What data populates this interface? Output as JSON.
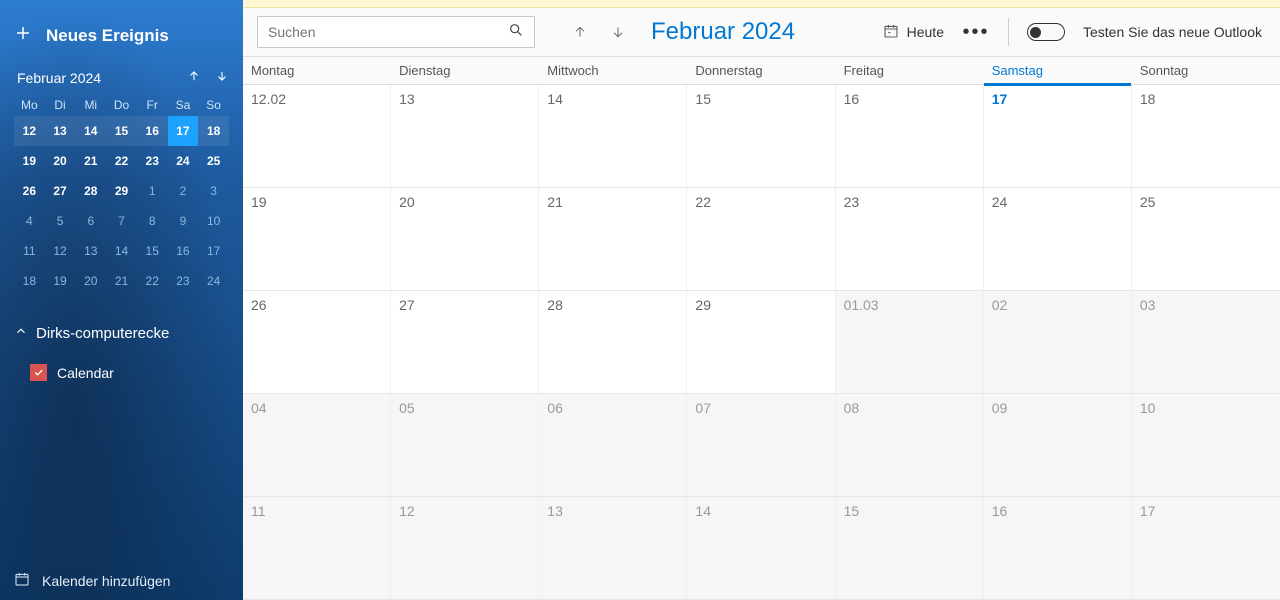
{
  "sidebar": {
    "new_event": "Neues Ereignis",
    "mini": {
      "title": "Februar 2024",
      "dow": [
        "Mo",
        "Di",
        "Mi",
        "Do",
        "Fr",
        "Sa",
        "So"
      ],
      "cells": [
        {
          "n": "12",
          "cls": "in-month week-hl"
        },
        {
          "n": "13",
          "cls": "in-month week-hl"
        },
        {
          "n": "14",
          "cls": "in-month week-hl"
        },
        {
          "n": "15",
          "cls": "in-month week-hl"
        },
        {
          "n": "16",
          "cls": "in-month week-hl"
        },
        {
          "n": "17",
          "cls": "in-month today"
        },
        {
          "n": "18",
          "cls": "in-month week-hl"
        },
        {
          "n": "19",
          "cls": "in-month"
        },
        {
          "n": "20",
          "cls": "in-month"
        },
        {
          "n": "21",
          "cls": "in-month"
        },
        {
          "n": "22",
          "cls": "in-month"
        },
        {
          "n": "23",
          "cls": "in-month"
        },
        {
          "n": "24",
          "cls": "in-month"
        },
        {
          "n": "25",
          "cls": "in-month"
        },
        {
          "n": "26",
          "cls": "in-month"
        },
        {
          "n": "27",
          "cls": "in-month"
        },
        {
          "n": "28",
          "cls": "in-month"
        },
        {
          "n": "29",
          "cls": "in-month"
        },
        {
          "n": "1",
          "cls": "other"
        },
        {
          "n": "2",
          "cls": "other"
        },
        {
          "n": "3",
          "cls": "other"
        },
        {
          "n": "4",
          "cls": "other"
        },
        {
          "n": "5",
          "cls": "other"
        },
        {
          "n": "6",
          "cls": "other"
        },
        {
          "n": "7",
          "cls": "other"
        },
        {
          "n": "8",
          "cls": "other"
        },
        {
          "n": "9",
          "cls": "other"
        },
        {
          "n": "10",
          "cls": "other"
        },
        {
          "n": "11",
          "cls": "other"
        },
        {
          "n": "12",
          "cls": "other"
        },
        {
          "n": "13",
          "cls": "other"
        },
        {
          "n": "14",
          "cls": "other"
        },
        {
          "n": "15",
          "cls": "other"
        },
        {
          "n": "16",
          "cls": "other"
        },
        {
          "n": "17",
          "cls": "other"
        },
        {
          "n": "18",
          "cls": "other"
        },
        {
          "n": "19",
          "cls": "other"
        },
        {
          "n": "20",
          "cls": "other"
        },
        {
          "n": "21",
          "cls": "other"
        },
        {
          "n": "22",
          "cls": "other"
        },
        {
          "n": "23",
          "cls": "other"
        },
        {
          "n": "24",
          "cls": "other"
        }
      ]
    },
    "account_name": "Dirks-computerecke",
    "calendar_name": "Calendar",
    "add_calendar": "Kalender hinzufügen"
  },
  "toolbar": {
    "search_placeholder": "Suchen",
    "month_title": "Februar 2024",
    "today_label": "Heute",
    "try_outlook": "Testen Sie das neue Outlook"
  },
  "grid": {
    "dow": [
      "Montag",
      "Dienstag",
      "Mittwoch",
      "Donnerstag",
      "Freitag",
      "Samstag",
      "Sonntag"
    ],
    "today_col_index": 5,
    "weeks": [
      [
        {
          "t": "12.02"
        },
        {
          "t": "13"
        },
        {
          "t": "14"
        },
        {
          "t": "15"
        },
        {
          "t": "16"
        },
        {
          "t": "17",
          "today": true
        },
        {
          "t": "18"
        }
      ],
      [
        {
          "t": "19"
        },
        {
          "t": "20"
        },
        {
          "t": "21"
        },
        {
          "t": "22"
        },
        {
          "t": "23"
        },
        {
          "t": "24"
        },
        {
          "t": "25"
        }
      ],
      [
        {
          "t": "26"
        },
        {
          "t": "27"
        },
        {
          "t": "28"
        },
        {
          "t": "29"
        },
        {
          "t": "01.03",
          "other": true
        },
        {
          "t": "02",
          "other": true
        },
        {
          "t": "03",
          "other": true
        }
      ],
      [
        {
          "t": "04",
          "other": true
        },
        {
          "t": "05",
          "other": true
        },
        {
          "t": "06",
          "other": true
        },
        {
          "t": "07",
          "other": true
        },
        {
          "t": "08",
          "other": true
        },
        {
          "t": "09",
          "other": true
        },
        {
          "t": "10",
          "other": true
        }
      ],
      [
        {
          "t": "11",
          "other": true
        },
        {
          "t": "12",
          "other": true
        },
        {
          "t": "13",
          "other": true
        },
        {
          "t": "14",
          "other": true
        },
        {
          "t": "15",
          "other": true
        },
        {
          "t": "16",
          "other": true
        },
        {
          "t": "17",
          "other": true
        }
      ]
    ]
  }
}
